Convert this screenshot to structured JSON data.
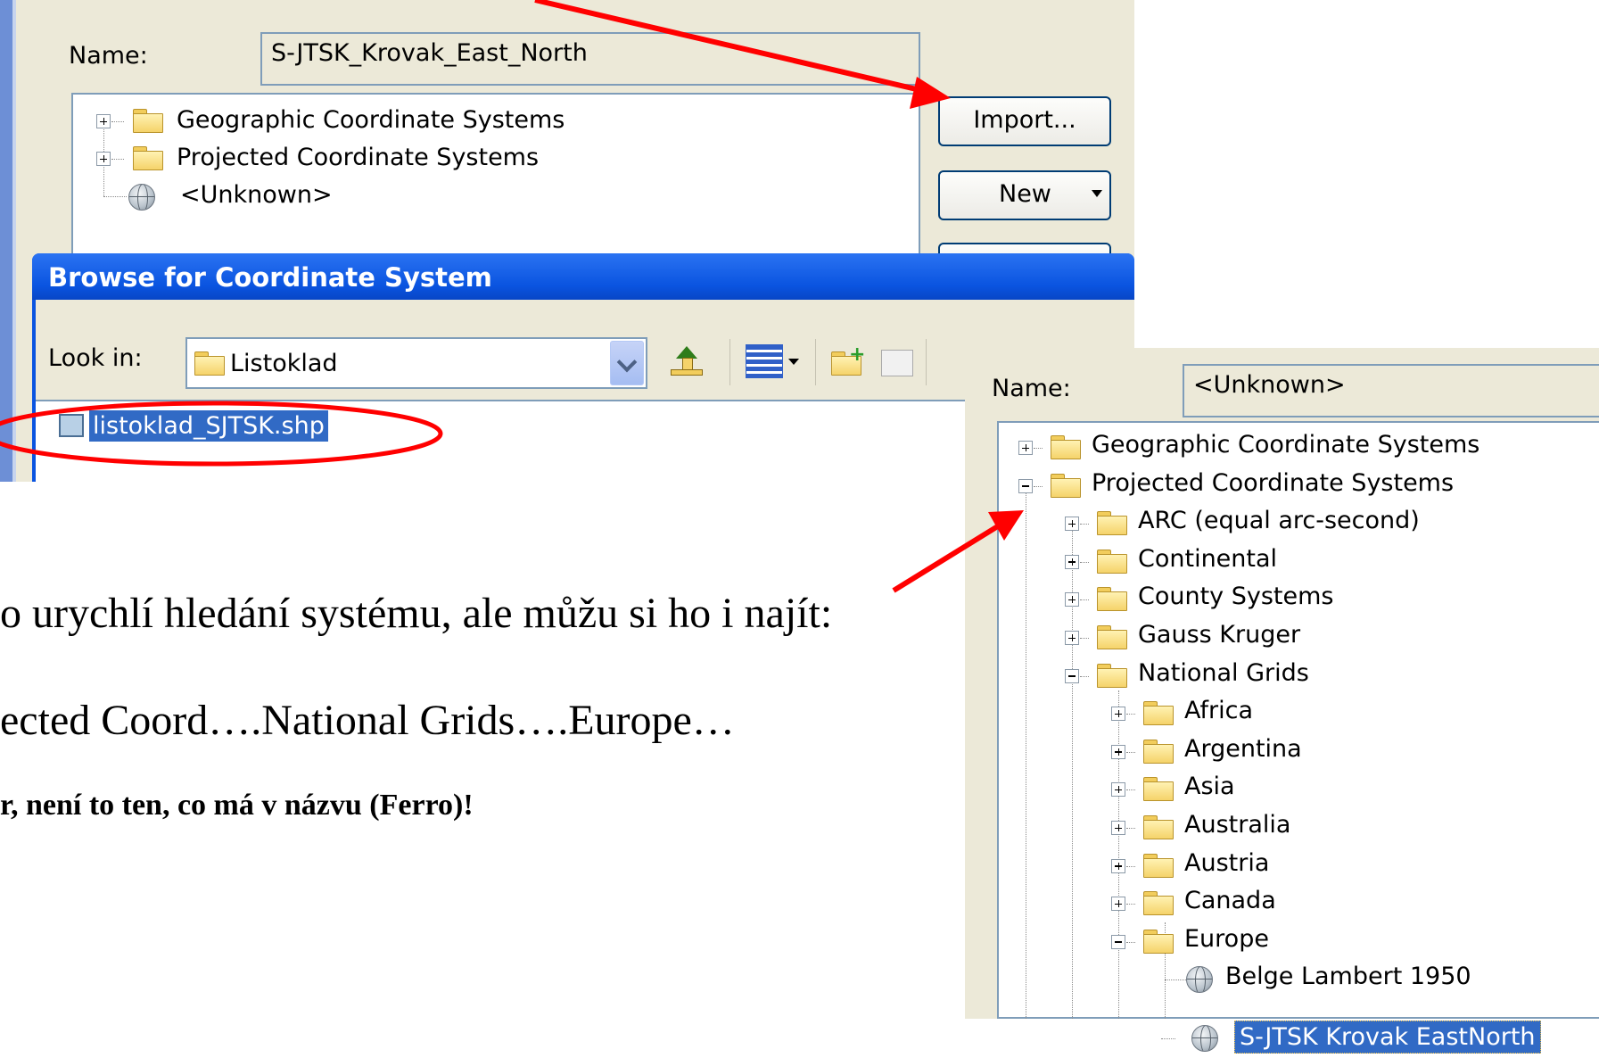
{
  "top_dialog": {
    "name_label": "Name:",
    "name_value": "S-JTSK_Krovak_East_North",
    "tree": [
      {
        "label": "Geographic Coordinate Systems",
        "icon": "folder-icon",
        "toggle": "+"
      },
      {
        "label": "Projected Coordinate Systems",
        "icon": "folder-icon",
        "toggle": "+"
      },
      {
        "label": "<Unknown>",
        "icon": "globe-icon",
        "toggle": ""
      }
    ],
    "import_button": "Import...",
    "new_button": "New"
  },
  "browse_dialog": {
    "title": "Browse for Coordinate System",
    "look_in_label": "Look in:",
    "look_in_value": "Listoklad",
    "file": "listoklad_SJTSK.shp"
  },
  "second_dialog": {
    "name_label": "Name:",
    "name_value": "<Unknown>",
    "tree": [
      {
        "label": "Geographic Coordinate Systems",
        "level": 0,
        "toggle": "+",
        "icon": "folder-icon"
      },
      {
        "label": "Projected Coordinate Systems",
        "level": 0,
        "toggle": "-",
        "icon": "folder-icon"
      },
      {
        "label": "ARC (equal arc-second)",
        "level": 1,
        "toggle": "+",
        "icon": "folder-icon"
      },
      {
        "label": "Continental",
        "level": 1,
        "toggle": "+",
        "icon": "folder-icon"
      },
      {
        "label": "County Systems",
        "level": 1,
        "toggle": "+",
        "icon": "folder-icon"
      },
      {
        "label": "Gauss Kruger",
        "level": 1,
        "toggle": "+",
        "icon": "folder-icon"
      },
      {
        "label": "National Grids",
        "level": 1,
        "toggle": "-",
        "icon": "folder-icon"
      },
      {
        "label": "Africa",
        "level": 2,
        "toggle": "+",
        "icon": "folder-icon"
      },
      {
        "label": "Argentina",
        "level": 2,
        "toggle": "+",
        "icon": "folder-icon"
      },
      {
        "label": "Asia",
        "level": 2,
        "toggle": "+",
        "icon": "folder-icon"
      },
      {
        "label": "Australia",
        "level": 2,
        "toggle": "+",
        "icon": "folder-icon"
      },
      {
        "label": "Austria",
        "level": 2,
        "toggle": "+",
        "icon": "folder-icon"
      },
      {
        "label": "Canada",
        "level": 2,
        "toggle": "+",
        "icon": "folder-icon"
      },
      {
        "label": "Europe",
        "level": 2,
        "toggle": "-",
        "icon": "folder-icon"
      },
      {
        "label": "Belge Lambert 1950",
        "level": 3,
        "toggle": "",
        "icon": "globe-icon"
      }
    ],
    "selected_item": "S-JTSK Krovak EastNorth"
  },
  "slide_text": {
    "line1": "o urychlí hledání systému, ale můžu si ho i najít:",
    "line2": "ected Coord….National Grids….Europe…",
    "line3": "r, není to ten, co má v názvu (Ferro)!"
  },
  "colors": {
    "annotation": "#ff0000",
    "selection": "#316ac5",
    "xp_title": "#0a54e0"
  }
}
